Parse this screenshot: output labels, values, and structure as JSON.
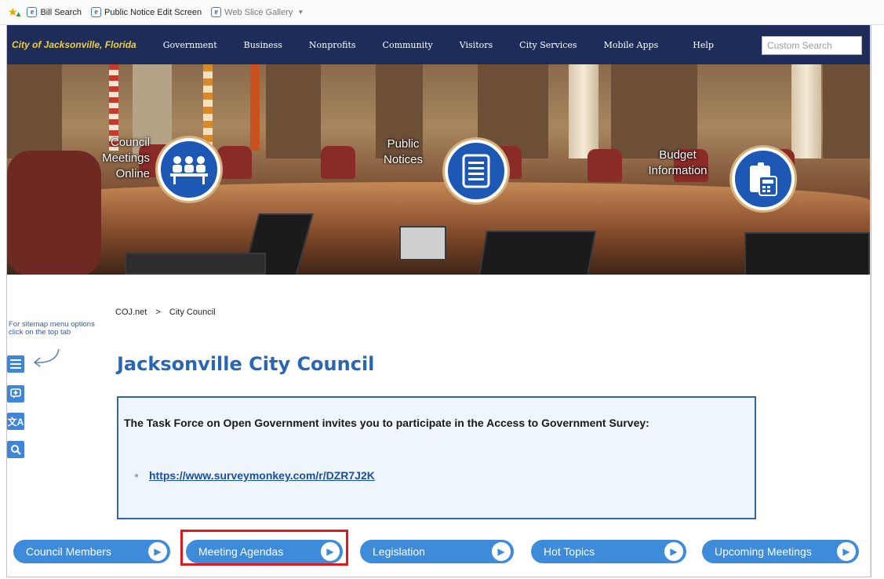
{
  "favorites_bar": {
    "items": [
      {
        "label": "Bill Search"
      },
      {
        "label": "Public Notice Edit Screen"
      },
      {
        "label": "Web Slice Gallery"
      }
    ]
  },
  "site_nav": {
    "logo": "City of Jacksonville, Florida",
    "links": [
      "Government",
      "Business",
      "Nonprofits",
      "Community",
      "Visitors",
      "City Services",
      "Mobile Apps",
      "Help"
    ],
    "search_placeholder": "Custom Search"
  },
  "hero": {
    "features": [
      {
        "label_lines": [
          "Council",
          "Meetings",
          "Online"
        ],
        "icon": "people-at-table-icon"
      },
      {
        "label_lines": [
          "Public",
          "Notices"
        ],
        "icon": "document-list-icon"
      },
      {
        "label_lines": [
          "Budget",
          "Information"
        ],
        "icon": "calculator-icon"
      }
    ]
  },
  "breadcrumb": {
    "home": "COJ.net",
    "separator": ">",
    "current": "City Council"
  },
  "sidebar": {
    "hint": "For sitemap menu options click on the top tab",
    "icons": [
      "menu-icon",
      "feedback-icon",
      "translate-icon",
      "search-icon"
    ]
  },
  "page_title": "Jacksonville City Council",
  "notice": {
    "text": "The Task Force on Open Government invites you to participate in the Access to Government Survey:",
    "link": "https://www.surveymonkey.com/r/DZR7J2K"
  },
  "buttons": [
    "Council Members",
    "Meeting Agendas",
    "Legislation",
    "Hot Topics",
    "Upcoming Meetings"
  ],
  "colors": {
    "nav_bg": "#1e2c5a",
    "logo": "#f3cf36",
    "accent_blue": "#3d8bd9",
    "title_blue": "#2a67b1",
    "highlight_red": "#e0181d"
  }
}
